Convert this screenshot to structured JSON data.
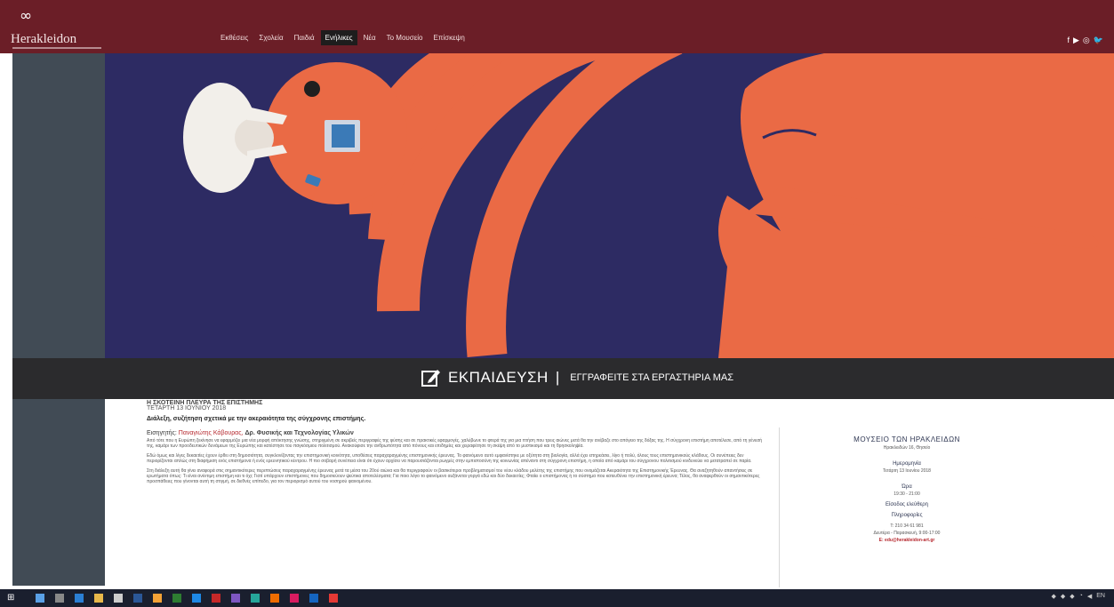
{
  "header": {
    "logo_mark": "∞",
    "logo_text": "Herakleidon",
    "nav": [
      "Εκθέσεις",
      "Σχολεία",
      "Παιδιά",
      "Ενήλικες",
      "Νέα",
      "Το Μουσείο",
      "Επίσκεψη"
    ],
    "active_nav": "Ενήλικες",
    "social": [
      "f",
      "▶",
      "◎",
      "🐦"
    ]
  },
  "banner": {
    "title": "ΕΚΠΑΙΔΕΥΣΗ",
    "separator": "|",
    "subtitle": "ΕΓΓΡΑΦΕΙΤΕ ΣΤΑ ΕΡΓΑΣΤΗΡΙΑ ΜΑΣ"
  },
  "event": {
    "title": "Η ΣΚΟΤΕΙΝΗ ΠΛΕΥΡΑ ΤΗΣ ΕΠΙΣΤΗΜΗΣ",
    "date": "ΤΕΤΑΡΤΗ 13 ΙΟΥΝΙΟΥ 2018",
    "subtitle": "Διάλεξη, συζήτηση σχετικά με την ακεραιότητα της σύγχρονης επιστήμης.",
    "speaker_label": "Εισηγητής:",
    "speaker_name": "Παναγιώτης Κάβουρας,",
    "speaker_role": "Δρ. Φυσικής και Τεχνολογίας Υλικών",
    "paragraphs": [
      "Από τότε που η Ευρώπη ξεκίνησε να εφαρμόζει μια νέα μορφή απόκτησης γνώσης, στηριγμένη σε ακριβείς περιγραφές της φύσης και σε πρακτικές εφαρμογές, χαλύβωνε το φτερά της για μια πτήση που τρεις αιώνες μετά θα την ανέβαζε στο απόγειο της δόξας της. Η σύγχρονη επιστήμη αποτέλεσε, από τη γένεσή της, καμάρι των προοδευτικών δυνάμεων της Ευρώπης και κατέστησε του παγκόσμιου πολιτισμού. Ανακούφισε την ανθρωπότητα από πόνους και επιδημίες και χειραφέτησε τη σκέψη από το μυστικισμό και τη θρησκοληψία.",
      "Εδώ όμως και λίγες δεκαετίες έχουν έρθει στη δημοσιότητα, συγκλονίζοντας την επιστημονική κοινότητα, υποθέσεις παραχαραγμένης επιστημονικής έρευνας. Το φαινόμενο αυτό εμφανίστηκε με οξύτητα στη βιολογία, αλλά έχει επηρεάσει, λίγο ή πολύ, όλους τους επιστημονικούς κλάδους. Οι συνέπειες δεν περιορίζονται απλώς στη διαφήμιση ενός επιστήμονα ή ενός ερευνητικού κέντρου. Η πιο σοβαρή συνέπεια είναι ότι έχουν αρχίσει να παρουσιάζονται ρωγμές στην εμπιστοσύνη της κοινωνίας απέναντι στη σύγχρονη επιστήμη, η οποία από καμάρι του σύγχρονου πολιτισμού κινδυνεύει να μετατραπεί σε παρία.",
      "Στη διάλεξη αυτή θα γίνει αναφορά στις σημαντικότερες περιπτώσεις παραχαραγμένης έρευνας μετά τα μέσα του 20ού αιώνα και θα περιγραφούν οι βασικότεροι προβληματισμοί του νέου κλάδου μελέτης της επιστήμης που ονομάζεται Ακεραιότητα της Επιστημονικής Έρευνας. Θα αναζητηθούν απαντήσεις σε ερωτήματα όπως: Τι είναι ανέντιμη επιστήμη και τι όχι; Γιατί υπάρχουν επιστήμονες που δημοσιεύουν ψεύτικα αποτελέσματα; Για ποιο λόγο το φαινόμενο αυξάνεται γοργά εδώ και δύο δεκαετίες; Φταίει ο επιστήμονας ή το σύστημα που κατευθύνει την επιστημονική έρευνα; Τέλος, θα αναφερθούν οι σημαντικότερες προσπάθειες που γίνονται αυτή τη στιγμή, σε διεθνές επίπεδο, για τον περιορισμό αυτού του νοσηρού φαινομένου."
    ]
  },
  "info": {
    "museum": "ΜΟΥΣΕΙΟ ΤΩΝ ΗΡΑΚΛΕΙΔΩΝ",
    "address": "Ηρακλειδών 16, Θησείο",
    "date_label": "Ημερομηνία",
    "date": "Τετάρτη 13 Ιουνίου 2018",
    "time_label": "Ώρα",
    "time": "19:30 - 21:00",
    "entrance": "Είσοδος ελεύθερη",
    "info_label": "Πληροφορίες",
    "phone": "Τ: 210 34 61 981",
    "hours": "Δευτέρα - Παρασκευή, 9:00-17:00",
    "email": "E: edu@herakleidon-art.gr"
  },
  "taskbar": {
    "lang": "EN"
  },
  "colors": {
    "header": "#6b1e27",
    "hero_bg": "#2d2b63",
    "hero_orange": "#ea6a45",
    "banner": "#2b2b2d",
    "accent_red": "#b6282e"
  }
}
